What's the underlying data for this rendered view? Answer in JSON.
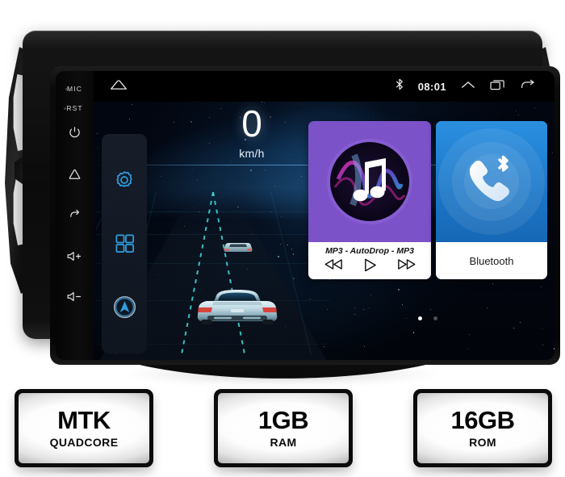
{
  "device": {
    "bezel_keys": [
      {
        "label": "MIC",
        "icon": "mic-pinhole"
      },
      {
        "label": "RST",
        "icon": "reset-pinhole"
      },
      {
        "label": "",
        "icon": "power-icon"
      },
      {
        "label": "",
        "icon": "home-icon"
      },
      {
        "label": "",
        "icon": "back-icon"
      },
      {
        "label": "",
        "icon": "volume-up-icon"
      },
      {
        "label": "",
        "icon": "volume-down-icon"
      }
    ]
  },
  "statusbar": {
    "home_icon": "home-icon",
    "bluetooth_icon": "bluetooth-icon",
    "time": "08:01",
    "expand_icon": "chevron-up-icon",
    "recents_icon": "recent-apps-icon",
    "back_icon": "back-arrow-icon"
  },
  "dock": {
    "items": [
      {
        "name": "settings",
        "icon": "gear-icon"
      },
      {
        "name": "all-apps",
        "icon": "apps-grid-icon"
      },
      {
        "name": "navigation",
        "icon": "navigation-compass-icon"
      }
    ]
  },
  "speedometer": {
    "value": "0",
    "unit": "km/h"
  },
  "widgets": {
    "music": {
      "icon": "music-note-icon",
      "track": "MP3 - AutoDrop - MP3",
      "prev_icon": "previous-track-icon",
      "play_icon": "play-icon",
      "next_icon": "next-track-icon",
      "accent": "#7b52c8"
    },
    "bluetooth": {
      "icon": "bluetooth-phone-icon",
      "label": "Bluetooth",
      "accent": "#1572c4"
    }
  },
  "pager": {
    "dots": [
      {
        "active": true
      },
      {
        "active": false
      }
    ]
  },
  "specs": [
    {
      "main": "MTK",
      "sub": "QUADCORE"
    },
    {
      "main": "1GB",
      "sub": "RAM"
    },
    {
      "main": "16GB",
      "sub": "ROM"
    }
  ]
}
